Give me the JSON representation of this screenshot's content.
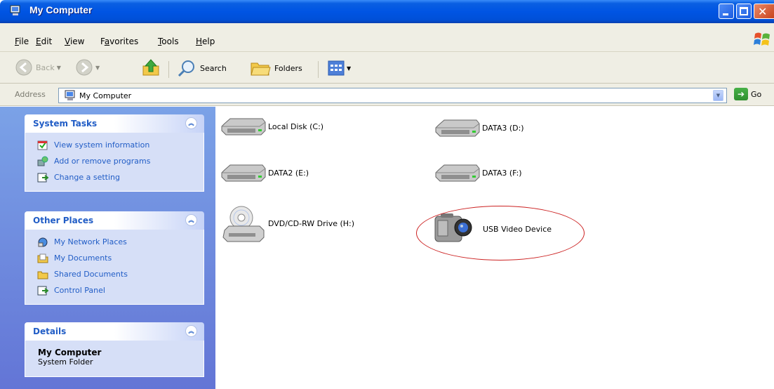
{
  "window": {
    "title": "My Computer"
  },
  "menu": {
    "items": [
      {
        "label": "File",
        "hotkey": "F",
        "rest": "ile"
      },
      {
        "label": "Edit",
        "hotkey": "E",
        "rest": "dit"
      },
      {
        "label": "View",
        "hotkey": "V",
        "rest": "iew"
      },
      {
        "label": "Favorites",
        "hotkey": "a",
        "pre": "F",
        "rest": "vorites"
      },
      {
        "label": "Tools",
        "hotkey": "T",
        "rest": "ools"
      },
      {
        "label": "Help",
        "hotkey": "H",
        "rest": "elp"
      }
    ]
  },
  "toolbar": {
    "back_label": "Back",
    "search_label": "Search",
    "folders_label": "Folders"
  },
  "address": {
    "label": "Address",
    "value": "My Computer",
    "go_label": "Go"
  },
  "taskpane": {
    "system_tasks": {
      "title": "System Tasks",
      "items": [
        {
          "label": "View system information",
          "icon": "system-info-icon"
        },
        {
          "label": "Add or remove programs",
          "icon": "add-remove-programs-icon"
        },
        {
          "label": "Change a setting",
          "icon": "control-panel-icon"
        }
      ]
    },
    "other_places": {
      "title": "Other Places",
      "items": [
        {
          "label": "My Network Places",
          "icon": "network-places-icon"
        },
        {
          "label": "My Documents",
          "icon": "documents-folder-icon"
        },
        {
          "label": "Shared Documents",
          "icon": "shared-folder-icon"
        },
        {
          "label": "Control Panel",
          "icon": "control-panel-icon"
        }
      ]
    },
    "details": {
      "title": "Details",
      "name": "My Computer",
      "type": "System Folder"
    }
  },
  "drives": [
    {
      "label": "Local Disk (C:)",
      "icon": "hard-disk-icon"
    },
    {
      "label": "DATA3 (D:)",
      "icon": "hard-disk-icon"
    },
    {
      "label": "DATA2 (E:)",
      "icon": "hard-disk-icon"
    },
    {
      "label": "DATA3 (F:)",
      "icon": "hard-disk-icon"
    },
    {
      "label": "DVD/CD-RW Drive (H:)",
      "icon": "dvd-drive-icon"
    },
    {
      "label": "USB Video Device",
      "icon": "video-camera-icon"
    }
  ],
  "colors": {
    "titlebar": "#0054e3",
    "taskpane_link": "#215dc6",
    "annotation_circle": "#cc2222"
  }
}
